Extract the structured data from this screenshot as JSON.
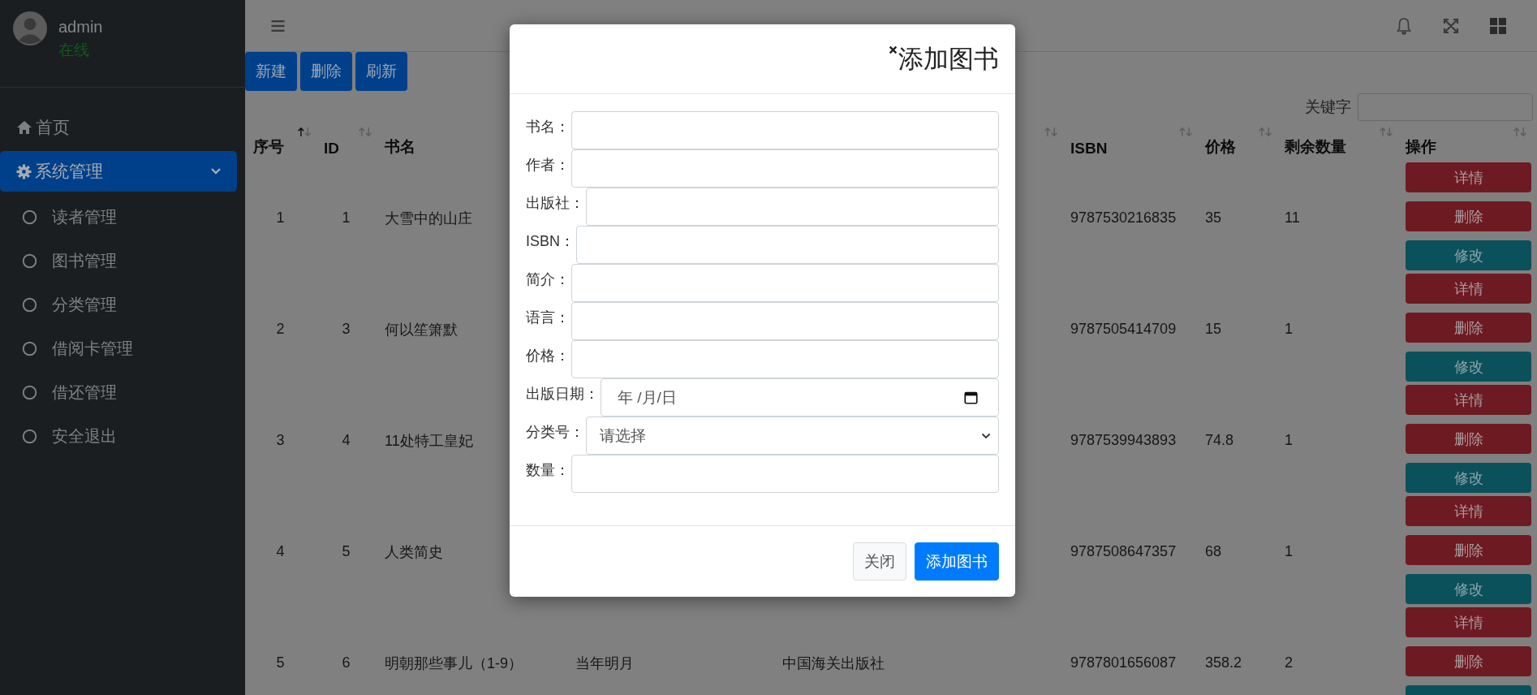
{
  "sidebar": {
    "user": {
      "name": "admin",
      "status": "在线"
    },
    "menu": [
      {
        "label": "首页",
        "selected": false
      },
      {
        "label": "系统管理",
        "selected": true,
        "expanded": true,
        "children": [
          {
            "label": "读者管理",
            "selected": false
          },
          {
            "label": "图书管理",
            "selected": false
          },
          {
            "label": "分类管理",
            "selected": false
          },
          {
            "label": "借阅卡管理",
            "selected": false
          },
          {
            "label": "借还管理",
            "selected": false
          },
          {
            "label": "安全退出",
            "selected": false
          }
        ]
      }
    ]
  },
  "toolbar": {
    "buttons": [
      "新建",
      "删除",
      "刷新"
    ]
  },
  "search": {
    "label": "关键字"
  },
  "table": {
    "columns": {
      "index": {
        "label": "序号",
        "sorted": true
      },
      "id": {
        "label": "ID",
        "sorted": false
      },
      "title": {
        "label": "书名"
      },
      "publisher": {
        "sorted": false
      },
      "isbn": {
        "label": "ISBN",
        "sorted": false
      },
      "price": {
        "label": "价格",
        "sorted": false
      },
      "stock": {
        "label": "剩余数量",
        "sorted": false
      },
      "actions": {
        "label": "操作",
        "sorted": false
      }
    },
    "rows": [
      {
        "index": "1",
        "id": "1",
        "title": "大雪中的山庄",
        "isbn": "9787530216835",
        "price": "35",
        "stock": "11",
        "actions": [
          {
            "label": "详情",
            "kind": "danger"
          },
          {
            "label": "删除",
            "kind": "danger"
          },
          {
            "label": "修改",
            "kind": "info"
          }
        ]
      },
      {
        "index": "2",
        "id": "3",
        "title": "何以笙箫默",
        "isbn": "9787505414709",
        "price": "15",
        "stock": "1",
        "actions": [
          {
            "label": "详情",
            "kind": "danger"
          },
          {
            "label": "删除",
            "kind": "danger"
          },
          {
            "label": "修改",
            "kind": "info"
          }
        ]
      },
      {
        "index": "3",
        "id": "4",
        "title": "11处特工皇妃",
        "isbn": "9787539943893",
        "price": "74.8",
        "stock": "1",
        "actions": [
          {
            "label": "详情",
            "kind": "danger"
          },
          {
            "label": "删除",
            "kind": "danger"
          },
          {
            "label": "修改",
            "kind": "info"
          }
        ]
      },
      {
        "index": "4",
        "id": "5",
        "title": "人类简史",
        "isbn": "9787508647357",
        "price": "68",
        "stock": "1",
        "actions": [
          {
            "label": "详情",
            "kind": "danger"
          },
          {
            "label": "删除",
            "kind": "danger"
          },
          {
            "label": "修改",
            "kind": "info"
          }
        ]
      },
      {
        "index": "5",
        "id": "6",
        "title": "明朝那些事儿（1-9）",
        "author": "当年明月",
        "publisher": "中国海关出版社",
        "isbn": "9787801656087",
        "price": "358.2",
        "stock": "2",
        "actions": [
          {
            "label": "详情",
            "kind": "danger"
          },
          {
            "label": "删除",
            "kind": "danger"
          },
          {
            "kind": "info"
          }
        ]
      }
    ]
  },
  "modal": {
    "title": "添加图书",
    "fields": [
      {
        "label": "书名：",
        "kind": "text"
      },
      {
        "label": "作者：",
        "kind": "text"
      },
      {
        "label": "出版社：",
        "kind": "text"
      },
      {
        "label": "ISBN：",
        "kind": "text"
      },
      {
        "label": "简介：",
        "kind": "text"
      },
      {
        "label": "语言：",
        "kind": "text"
      },
      {
        "label": "价格：",
        "kind": "text"
      },
      {
        "label": "出版日期：",
        "kind": "date",
        "placeholder": "年 /月/日"
      },
      {
        "label": "分类号：",
        "kind": "select",
        "value": "请选择"
      },
      {
        "label": "数量：",
        "kind": "text"
      }
    ],
    "buttons": [
      {
        "label": "关闭",
        "kind": "secondary"
      },
      {
        "label": "添加图书",
        "kind": "primary"
      }
    ]
  }
}
